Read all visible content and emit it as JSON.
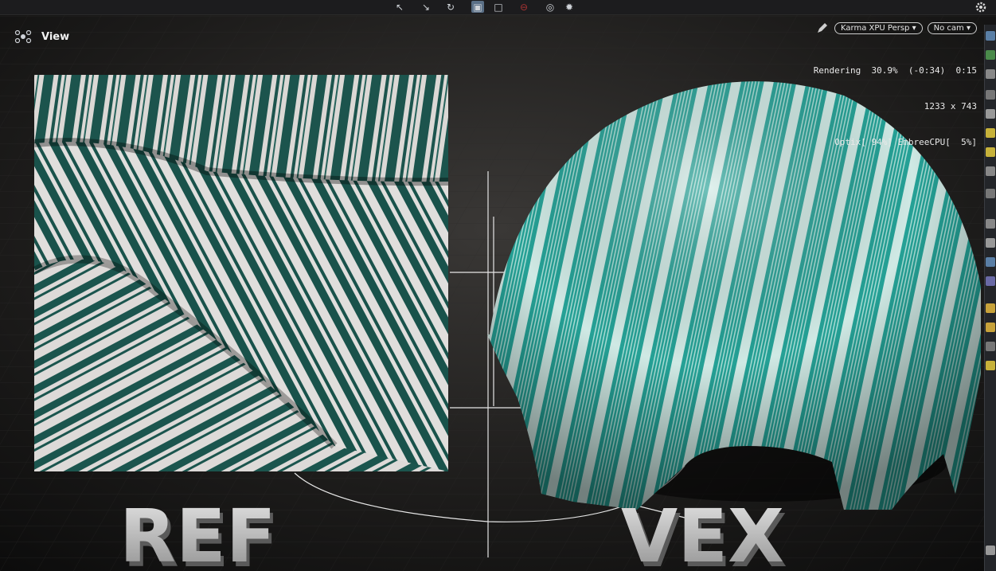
{
  "viewport": {
    "title": "View",
    "camera_menu": "Karma XPU Persp",
    "camera_select": "No cam",
    "hud": {
      "line1": "Rendering  30.9%  (-0:34)  0:15",
      "line2": "1233 x 743",
      "line3": "Optix[ 94%] EmbreeCPU[  5%]"
    },
    "scene_labels": {
      "left": "REF",
      "right": "VEX"
    }
  },
  "toolbar_icons": [
    "select-icon",
    "move-icon",
    "rotate-icon",
    "view-mode-icon",
    "snapshot-icon",
    "stop-icon",
    "camera-icon",
    "lights-icon",
    "gear-icon"
  ],
  "colors": {
    "viewport_bg": "#141414",
    "toolbar_bg": "#1c1c1e",
    "cloth_teal": "#2aa69a",
    "ref_green": "#1f5a52",
    "hud_text": "#e9e9e9"
  }
}
